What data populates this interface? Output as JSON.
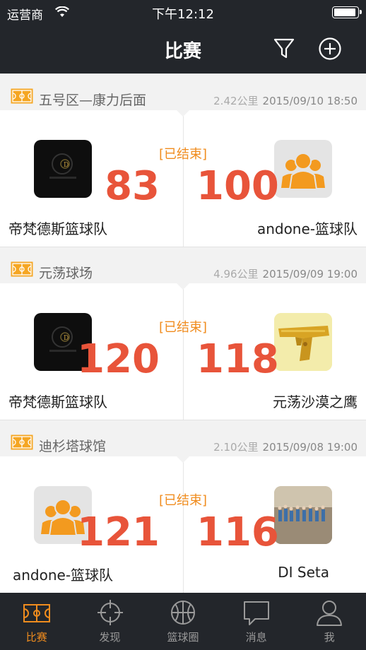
{
  "status_bar": {
    "carrier": "运营商",
    "time": "下午12:12",
    "battery_level": 0.95
  },
  "nav": {
    "title": "比赛",
    "filter_icon": "filter-icon",
    "add_icon": "plus-circle-icon"
  },
  "colors": {
    "accent": "#f08c1e",
    "score": "#e8543a",
    "bar": "#23262b"
  },
  "matches": [
    {
      "venue": "五号区—康力后面",
      "distance": "2.42公里",
      "datetime": "2015/09/10 18:50",
      "status": "[已结束]",
      "home": {
        "name": "帝梵德斯篮球队",
        "score": "83",
        "avatar": "team-logo-dark"
      },
      "away": {
        "name": "andone-篮球队",
        "score": "100",
        "avatar": "default-team-avatar"
      }
    },
    {
      "venue": "元荡球场",
      "distance": "4.96公里",
      "datetime": "2015/09/09 19:00",
      "status": "[已结束]",
      "home": {
        "name": "帝梵德斯篮球队",
        "score": "120",
        "avatar": "team-logo-dark"
      },
      "away": {
        "name": "元荡沙漠之鹰",
        "score": "118",
        "avatar": "desert-eagle-photo"
      }
    },
    {
      "venue": "迪杉塔球馆",
      "distance": "2.10公里",
      "datetime": "2015/09/08 19:00",
      "status": "[已结束]",
      "home": {
        "name": "andone-篮球队",
        "score": "121",
        "avatar": "default-team-avatar"
      },
      "away": {
        "name": "DI Seta",
        "score": "116",
        "avatar": "team-photo"
      }
    }
  ],
  "tabs": [
    {
      "label": "比赛",
      "icon": "court-icon",
      "active": true
    },
    {
      "label": "发现",
      "icon": "crosshair-icon",
      "active": false
    },
    {
      "label": "篮球圈",
      "icon": "basketball-icon",
      "active": false
    },
    {
      "label": "消息",
      "icon": "chat-bubble-icon",
      "active": false
    },
    {
      "label": "我",
      "icon": "user-icon",
      "active": false
    }
  ]
}
